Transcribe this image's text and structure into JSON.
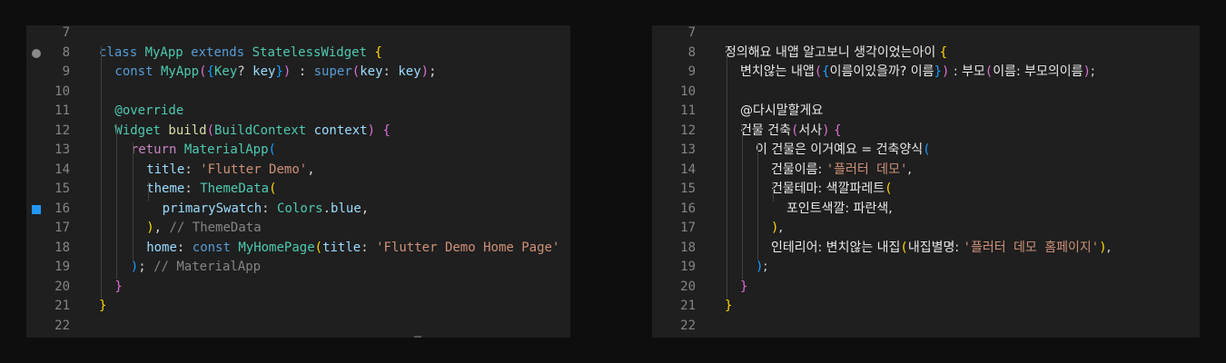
{
  "colors": {
    "background": "#0e0e0e",
    "editor_bg": "#1f1f1f",
    "line_number": "#858585",
    "breakpoint": "#8a8a8a",
    "color_swatch": "#2196f3"
  },
  "left_editor": {
    "lines": [
      {
        "n": "7",
        "segs": []
      },
      {
        "n": "8",
        "segs": [
          [
            "kw",
            "class "
          ],
          [
            "cls",
            "MyApp "
          ],
          [
            "kw",
            "extends "
          ],
          [
            "cls",
            "StatelessWidget "
          ],
          [
            "b1",
            "{"
          ]
        ]
      },
      {
        "n": "9",
        "segs": [
          [
            "kw",
            "const "
          ],
          [
            "cls",
            "MyApp"
          ],
          [
            "b2",
            "("
          ],
          [
            "b3",
            "{"
          ],
          [
            "cls",
            "Key"
          ],
          [
            "pl",
            "? "
          ],
          [
            "id",
            "key"
          ],
          [
            "b3",
            "}"
          ],
          [
            "b2",
            ")"
          ],
          [
            "pl",
            " : "
          ],
          [
            "kw",
            "super"
          ],
          [
            "b2",
            "("
          ],
          [
            "id",
            "key"
          ],
          [
            "pl",
            ": "
          ],
          [
            "id",
            "key"
          ],
          [
            "b2",
            ")"
          ],
          [
            "pl",
            ";"
          ]
        ]
      },
      {
        "n": "10",
        "segs": []
      },
      {
        "n": "11",
        "segs": [
          [
            "ann",
            "@override"
          ]
        ]
      },
      {
        "n": "12",
        "segs": [
          [
            "cls",
            "Widget "
          ],
          [
            "fn",
            "build"
          ],
          [
            "b2",
            "("
          ],
          [
            "cls",
            "BuildContext "
          ],
          [
            "id",
            "context"
          ],
          [
            "b2",
            ")"
          ],
          [
            "pl",
            " "
          ],
          [
            "b2",
            "{"
          ]
        ]
      },
      {
        "n": "13",
        "segs": [
          [
            "kr",
            "return "
          ],
          [
            "cls",
            "MaterialApp"
          ],
          [
            "b3",
            "("
          ]
        ]
      },
      {
        "n": "14",
        "segs": [
          [
            "id",
            "title"
          ],
          [
            "pl",
            ": "
          ],
          [
            "str",
            "'Flutter Demo'"
          ],
          [
            "pl",
            ","
          ]
        ]
      },
      {
        "n": "15",
        "segs": [
          [
            "id",
            "theme"
          ],
          [
            "pl",
            ": "
          ],
          [
            "cls",
            "ThemeData"
          ],
          [
            "b1",
            "("
          ]
        ]
      },
      {
        "n": "16",
        "segs": [
          [
            "id",
            "primarySwatch"
          ],
          [
            "pl",
            ": "
          ],
          [
            "cls",
            "Colors"
          ],
          [
            "pl",
            "."
          ],
          [
            "id",
            "blue"
          ],
          [
            "pl",
            ","
          ]
        ]
      },
      {
        "n": "17",
        "segs": [
          [
            "b1",
            ")"
          ],
          [
            "pl",
            ", "
          ],
          [
            "cmt",
            "// ThemeData"
          ]
        ]
      },
      {
        "n": "18",
        "segs": [
          [
            "id",
            "home"
          ],
          [
            "pl",
            ": "
          ],
          [
            "kw",
            "const "
          ],
          [
            "cls",
            "MyHomePage"
          ],
          [
            "b1",
            "("
          ],
          [
            "id",
            "title"
          ],
          [
            "pl",
            ": "
          ],
          [
            "str",
            "'Flutter Demo Home Page'"
          ]
        ]
      },
      {
        "n": "19",
        "segs": [
          [
            "b3",
            ")"
          ],
          [
            "pl",
            "; "
          ],
          [
            "cmt",
            "// MaterialApp"
          ]
        ]
      },
      {
        "n": "20",
        "segs": [
          [
            "b2",
            "}"
          ]
        ]
      },
      {
        "n": "21",
        "segs": [
          [
            "b1",
            "}"
          ]
        ]
      },
      {
        "n": "22",
        "segs": []
      }
    ]
  },
  "right_editor": {
    "lines": [
      {
        "n": "7",
        "segs": []
      },
      {
        "n": "8",
        "segs": [
          [
            "ko",
            "정의해요 내앱 알고보니 생각이었는아이 "
          ],
          [
            "b1",
            "{"
          ]
        ]
      },
      {
        "n": "9",
        "segs": [
          [
            "ko",
            "변치않는 내앱"
          ],
          [
            "b2",
            "("
          ],
          [
            "b3",
            "{"
          ],
          [
            "ko",
            "이름이있을까? 이름"
          ],
          [
            "b3",
            "}"
          ],
          [
            "b2",
            ")"
          ],
          [
            "ko",
            " : 부모"
          ],
          [
            "b2",
            "("
          ],
          [
            "ko",
            "이름: 부모의이름"
          ],
          [
            "b2",
            ")"
          ],
          [
            "ko",
            ";"
          ]
        ]
      },
      {
        "n": "10",
        "segs": []
      },
      {
        "n": "11",
        "segs": [
          [
            "ko",
            "@다시말할게요"
          ]
        ]
      },
      {
        "n": "12",
        "segs": [
          [
            "ko",
            "건물 건축"
          ],
          [
            "b2",
            "("
          ],
          [
            "ko",
            "서사"
          ],
          [
            "b2",
            ")"
          ],
          [
            "ko",
            " "
          ],
          [
            "b2",
            "{"
          ]
        ]
      },
      {
        "n": "13",
        "segs": [
          [
            "ko",
            "이 건물은 이거예요 = 건축양식"
          ],
          [
            "b3",
            "("
          ]
        ]
      },
      {
        "n": "14",
        "segs": [
          [
            "ko",
            "건물이름: "
          ],
          [
            "str",
            "'플러터 데모'"
          ],
          [
            "ko",
            ","
          ]
        ]
      },
      {
        "n": "15",
        "segs": [
          [
            "ko",
            "건물테마: 색깔파레트"
          ],
          [
            "b1",
            "("
          ]
        ]
      },
      {
        "n": "16",
        "segs": [
          [
            "ko",
            "포인트색깔: 파란색,"
          ]
        ]
      },
      {
        "n": "17",
        "segs": [
          [
            "b1",
            ")"
          ],
          [
            "ko",
            ","
          ]
        ]
      },
      {
        "n": "18",
        "segs": [
          [
            "ko",
            "인테리어: 변치않는 내집"
          ],
          [
            "b1",
            "("
          ],
          [
            "ko",
            "내집별명: "
          ],
          [
            "str",
            "'플러터 데모 홈페이지'"
          ],
          [
            "b1",
            ")"
          ],
          [
            "ko",
            ","
          ]
        ]
      },
      {
        "n": "19",
        "segs": [
          [
            "b3",
            ")"
          ],
          [
            "ko",
            ";"
          ]
        ]
      },
      {
        "n": "20",
        "segs": [
          [
            "b2",
            "}"
          ]
        ]
      },
      {
        "n": "21",
        "segs": [
          [
            "b1",
            "}"
          ]
        ]
      },
      {
        "n": "22",
        "segs": []
      }
    ]
  }
}
